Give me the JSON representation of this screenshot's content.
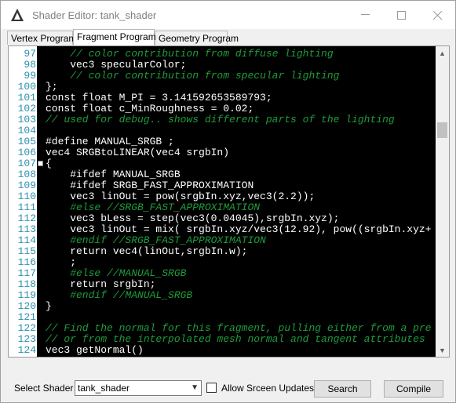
{
  "window": {
    "title": "Shader Editor: tank_shader"
  },
  "tabs": [
    {
      "label": "Vertex Program",
      "active": false
    },
    {
      "label": "Fragment Program",
      "active": true
    },
    {
      "label": "Geometry Program",
      "active": false
    }
  ],
  "editor": {
    "lines": [
      {
        "n": "97",
        "text": "    // color contribution from diffuse lighting",
        "kind": "comment"
      },
      {
        "n": "98",
        "text": "    vec3 specularColor;",
        "kind": "code"
      },
      {
        "n": "99",
        "text": "    // color contribution from specular lighting",
        "kind": "comment"
      },
      {
        "n": "100",
        "text": "};",
        "kind": "code"
      },
      {
        "n": "101",
        "text": "const float M_PI = 3.141592653589793;",
        "kind": "code"
      },
      {
        "n": "102",
        "text": "const float c_MinRoughness = 0.02;",
        "kind": "code"
      },
      {
        "n": "103",
        "text": "// used for debug.. shows different parts of the lighting",
        "kind": "comment"
      },
      {
        "n": "104",
        "text": "",
        "kind": "code"
      },
      {
        "n": "105",
        "text": "#define MANUAL_SRGB ;",
        "kind": "code"
      },
      {
        "n": "106",
        "text": "vec4 SRGBtoLINEAR(vec4 srgbIn)",
        "kind": "code"
      },
      {
        "n": "107",
        "text": "{",
        "kind": "code",
        "fold": true
      },
      {
        "n": "108",
        "text": "    #ifdef MANUAL_SRGB",
        "kind": "code"
      },
      {
        "n": "109",
        "text": "    #ifdef SRGB_FAST_APPROXIMATION",
        "kind": "code"
      },
      {
        "n": "110",
        "text": "    vec3 linOut = pow(srgbIn.xyz,vec3(2.2));",
        "kind": "code"
      },
      {
        "n": "111",
        "text": "    #else //SRGB_FAST_APPROXIMATION",
        "kind": "comment"
      },
      {
        "n": "112",
        "text": "    vec3 bLess = step(vec3(0.04045),srgbIn.xyz);",
        "kind": "code"
      },
      {
        "n": "113",
        "text": "    vec3 linOut = mix( srgbIn.xyz/vec3(12.92), pow((srgbIn.xyz+",
        "kind": "code"
      },
      {
        "n": "114",
        "text": "    #endif //SRGB_FAST_APPROXIMATION",
        "kind": "comment"
      },
      {
        "n": "115",
        "text": "    return vec4(linOut,srgbIn.w);",
        "kind": "code"
      },
      {
        "n": "116",
        "text": "    ;",
        "kind": "code"
      },
      {
        "n": "117",
        "text": "    #else //MANUAL_SRGB",
        "kind": "comment"
      },
      {
        "n": "118",
        "text": "    return srgbIn;",
        "kind": "code"
      },
      {
        "n": "119",
        "text": "    #endif //MANUAL_SRGB",
        "kind": "comment"
      },
      {
        "n": "120",
        "text": "}",
        "kind": "code"
      },
      {
        "n": "121",
        "text": "",
        "kind": "code"
      },
      {
        "n": "122",
        "text": "// Find the normal for this fragment, pulling either from a pre",
        "kind": "comment"
      },
      {
        "n": "123",
        "text": "// or from the interpolated mesh normal and tangent attributes",
        "kind": "comment"
      },
      {
        "n": "124",
        "text": "vec3 getNormal()",
        "kind": "code"
      }
    ]
  },
  "bottom": {
    "select_label": "Select Shader",
    "shader_value": "tank_shader",
    "allow_updates_label": "Allow Srceen Updates",
    "allow_updates_checked": false,
    "search_label": "Search",
    "compile_label": "Compile"
  },
  "colors": {
    "comment": "#1e9c3c",
    "code": "#ffffff",
    "line_number": "#2b91af",
    "editor_bg": "#000000"
  }
}
